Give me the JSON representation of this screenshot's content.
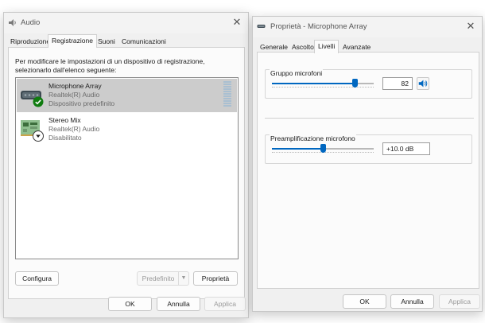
{
  "audio_window": {
    "title": "Audio",
    "tabs": [
      "Riproduzione",
      "Registrazione",
      "Suoni",
      "Comunicazioni"
    ],
    "active_tab": "Registrazione",
    "instructions": "Per modificare le impostazioni di un dispositivo di registrazione, selezionarlo dall'elenco seguente:",
    "devices": [
      {
        "name": "Microphone Array",
        "driver": "Realtek(R) Audio",
        "status": "Dispositivo predefinito",
        "selected": true,
        "badge": "green-check-icon"
      },
      {
        "name": "Stereo Mix",
        "driver": "Realtek(R) Audio",
        "status": "Disabilitato",
        "selected": false,
        "badge": "down-arrow-icon"
      }
    ],
    "configure_label": "Configura",
    "default_label": "Predefinito",
    "properties_label": "Proprietà",
    "ok_label": "OK",
    "cancel_label": "Annulla",
    "apply_label": "Applica"
  },
  "props_window": {
    "title": "Proprietà - Microphone Array",
    "tabs": [
      "Generale",
      "Ascolto",
      "Livelli",
      "Avanzate"
    ],
    "active_tab": "Livelli",
    "mic_group_label": "Gruppo microfoni",
    "mic_level_value": "82",
    "mic_level_fraction": 0.82,
    "boost_label": "Preamplificazione microfono",
    "boost_value": "+10.0 dB",
    "boost_fraction": 0.5,
    "ok_label": "OK",
    "cancel_label": "Annulla",
    "apply_label": "Applica"
  },
  "colors": {
    "accent": "#0067c0",
    "selected_row": "#cccccc",
    "check_green": "#107c10",
    "level_meter": "#a9bfd1"
  }
}
